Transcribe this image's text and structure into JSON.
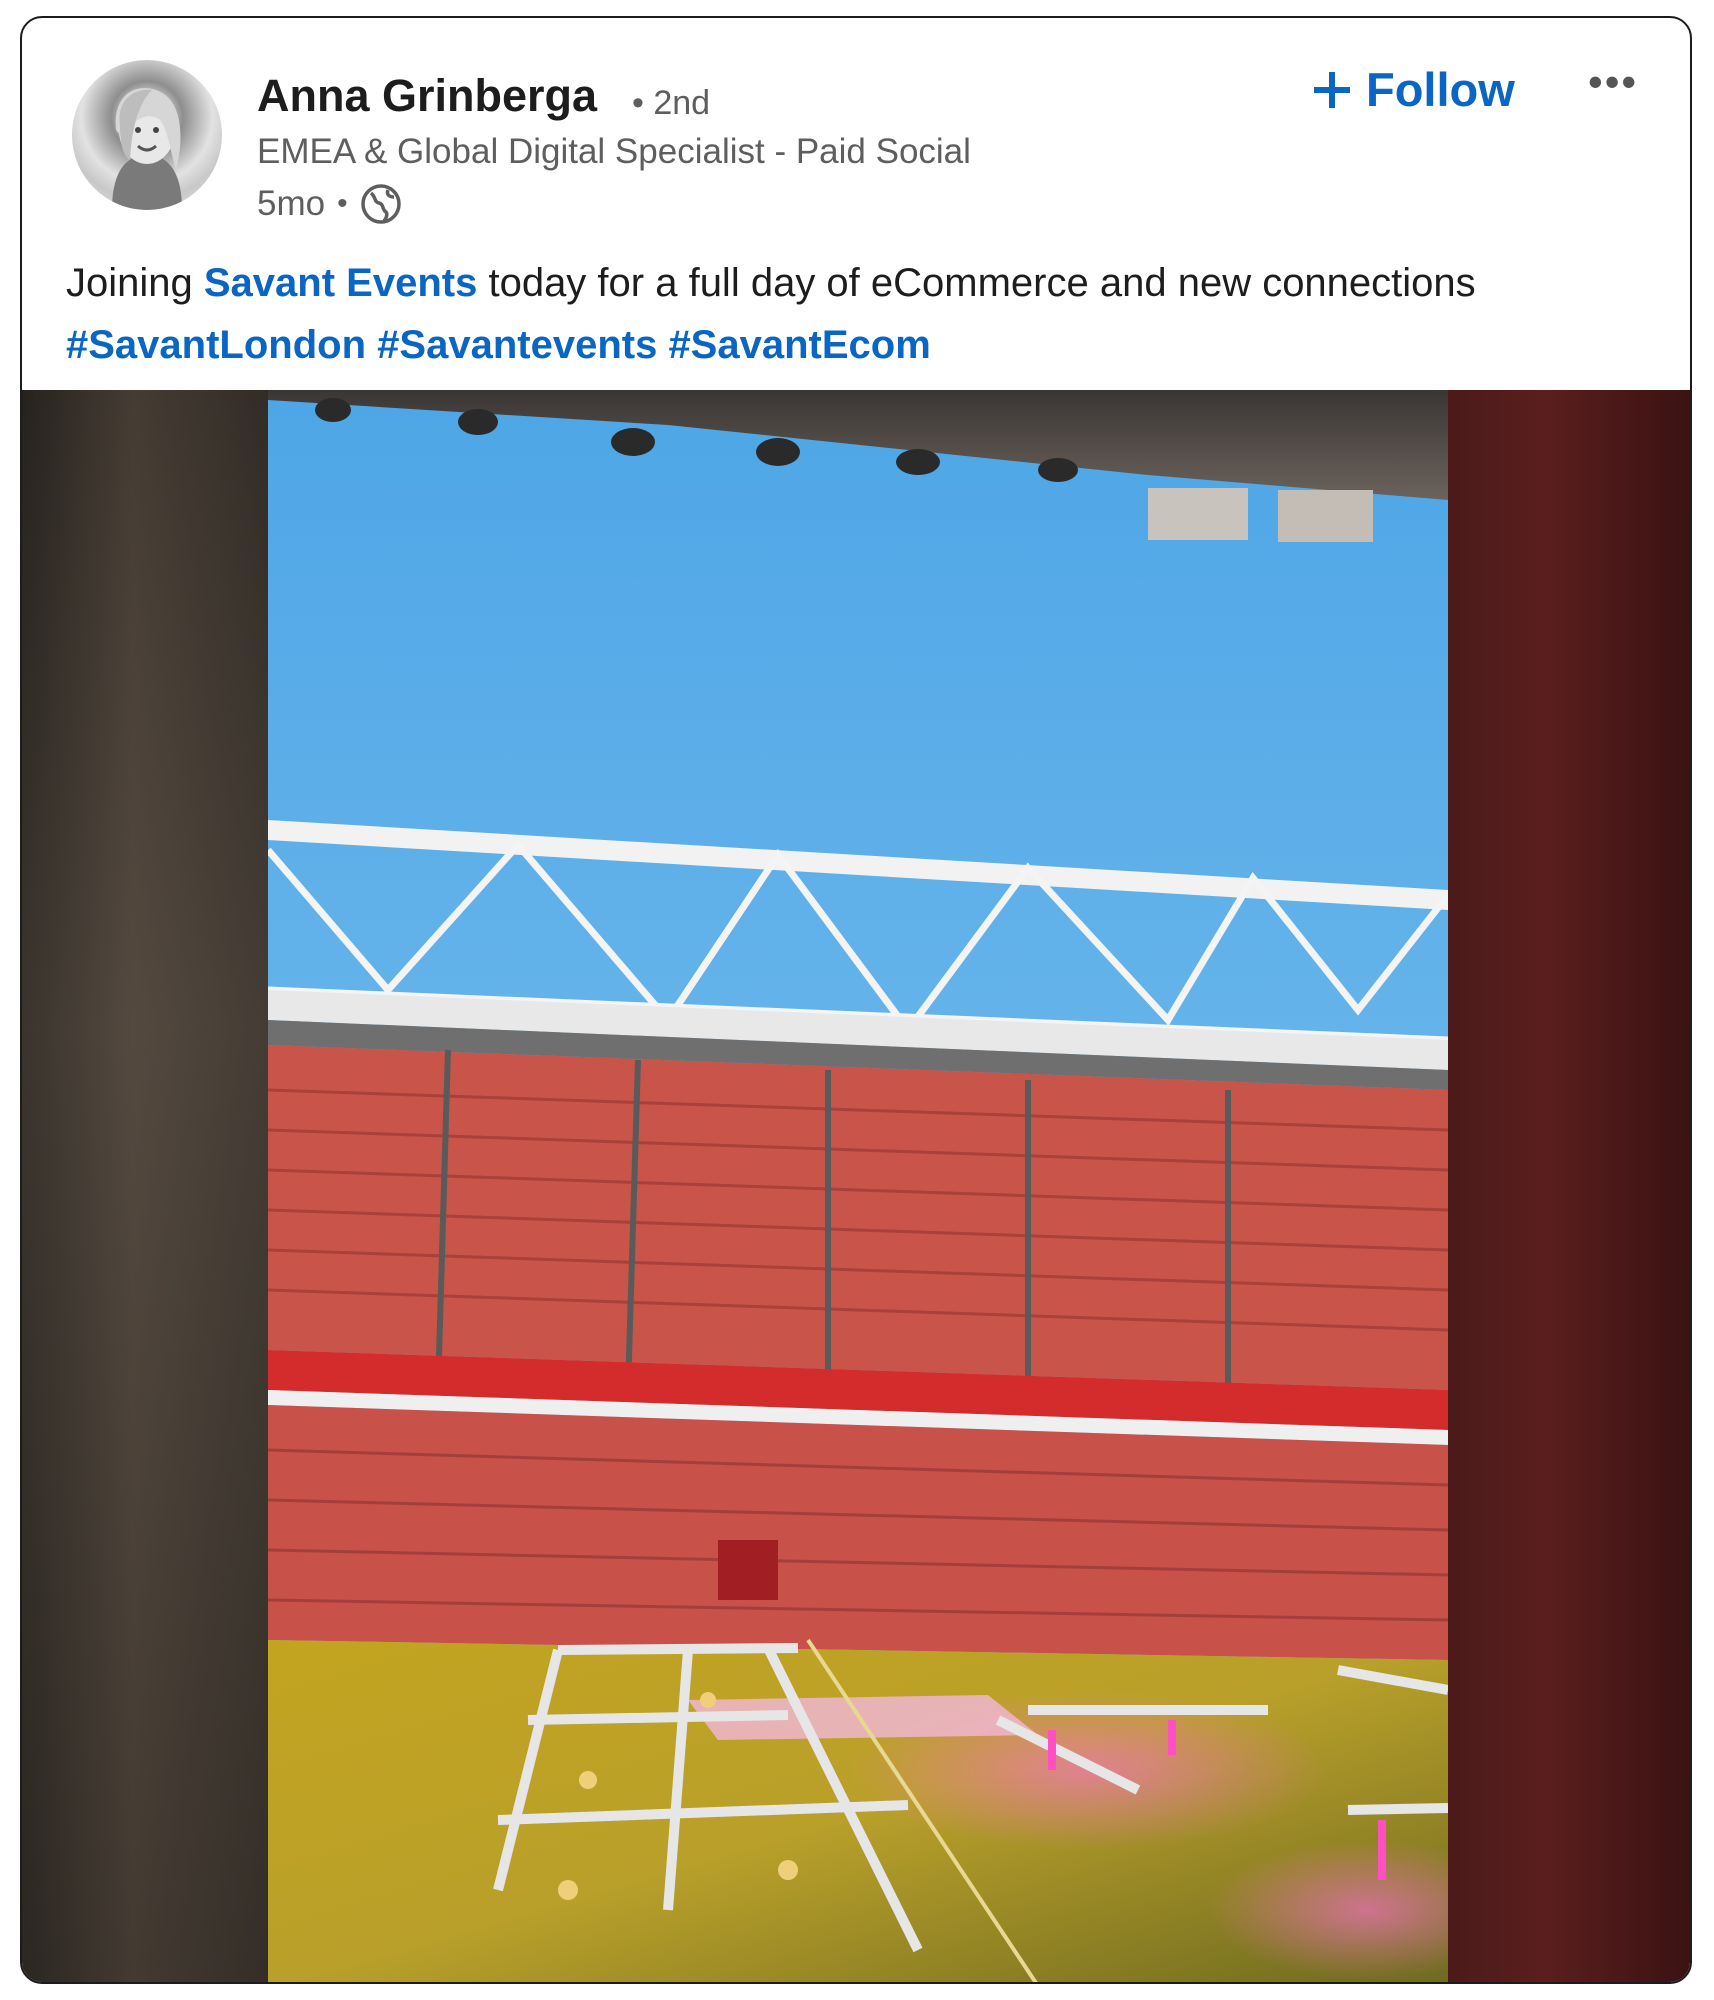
{
  "post": {
    "author": {
      "name": "Anna Grinberga",
      "degree": "• 2nd",
      "headline": "EMEA & Global Digital Specialist - Paid Social",
      "time": "5mo",
      "time_separator": "•"
    },
    "follow_label": "Follow",
    "follow_icon": "plus-icon",
    "more_label": "•••",
    "text": {
      "part1": "Joining ",
      "mention": "Savant Events",
      "part2": " today for a full day of eCommerce and new connections ",
      "hashtags": [
        "#SavantLondon",
        "#Savantevents",
        "#SavantEcom"
      ]
    },
    "media": {
      "kind": "video-frame",
      "subject": "stadium"
    }
  },
  "colors": {
    "link": "#0a66c2",
    "sky": "#6fb8ea",
    "seats": "#c9524a",
    "pitch": "#c9a823"
  }
}
